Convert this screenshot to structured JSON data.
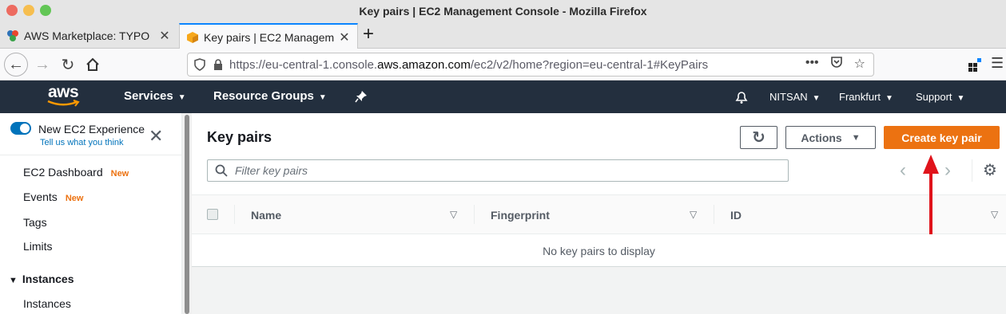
{
  "window": {
    "title": "Key pairs | EC2 Management Console - Mozilla Firefox"
  },
  "tabs": [
    {
      "title": "AWS Marketplace: TYPO",
      "active": false
    },
    {
      "title": "Key pairs | EC2 Managem",
      "active": true
    }
  ],
  "browser": {
    "url_prefix": "https://eu-central-1.console.",
    "url_domain": "aws.amazon.com",
    "url_suffix": "/ec2/v2/home?region=eu-central-1#KeyPairs",
    "more_icon": "•••"
  },
  "aws_header": {
    "logo": "aws",
    "services": "Services",
    "resource_groups": "Resource Groups",
    "account": "NITSAN",
    "region": "Frankfurt",
    "support": "Support"
  },
  "sidebar": {
    "experience_label": "New EC2 Experience",
    "feedback_link": "Tell us what you think",
    "items": [
      {
        "label": "EC2 Dashboard",
        "badge": "New"
      },
      {
        "label": "Events",
        "badge": "New"
      },
      {
        "label": "Tags",
        "badge": ""
      },
      {
        "label": "Limits",
        "badge": ""
      }
    ],
    "section": {
      "label": "Instances",
      "expand_icon": "▼"
    },
    "section_items": [
      {
        "label": "Instances"
      }
    ]
  },
  "main": {
    "title": "Key pairs",
    "actions_label": "Actions",
    "create_label": "Create key pair",
    "search_placeholder": "Filter key pairs",
    "columns": [
      "Name",
      "Fingerprint",
      "ID"
    ],
    "empty_message": "No key pairs to display"
  },
  "colors": {
    "aws_header_bg": "#232f3e",
    "primary_button": "#ec7211",
    "annotation_arrow": "#e0131b",
    "link": "#0073bb"
  }
}
